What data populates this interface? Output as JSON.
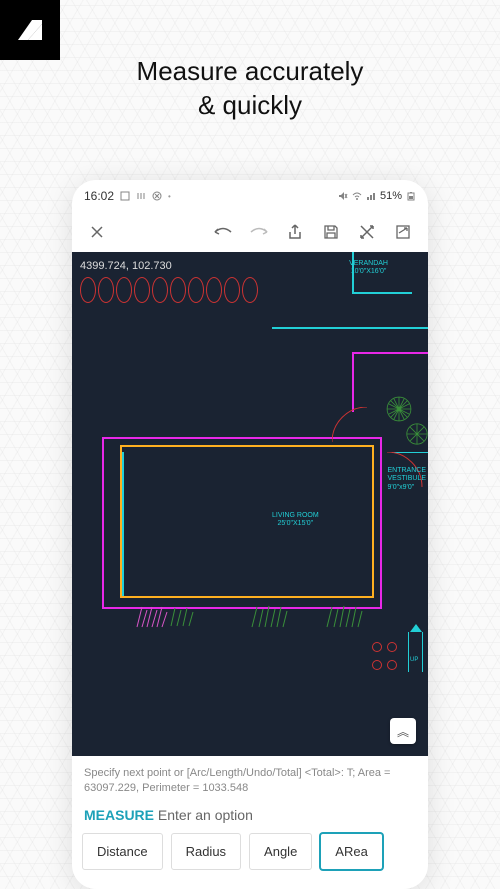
{
  "title_line1": "Measure accurately",
  "title_line2": "& quickly",
  "statusbar": {
    "time": "16:02",
    "battery": "51%"
  },
  "canvas": {
    "coords": "4399.724, 102.730",
    "verandah_label": "VERANDAH",
    "verandah_dim": "10'0\"X16'0\"",
    "living_label": "LIVING ROOM",
    "living_dim": "25'0\"X15'0\"",
    "entrance_label": "ENTRANCE",
    "entrance_label2": "VESTIBULE",
    "entrance_dim": "9'0\"x9'0\"",
    "fab_glyph": "︽",
    "up_label": "UP"
  },
  "cmdline": "Specify next point or [Arc/Length/Undo/Total] <Total>: T; Area = 63097.229, Perimeter = 1033.548",
  "prompt": {
    "command": "MEASURE",
    "text": "Enter an option"
  },
  "options": [
    {
      "label": "Distance"
    },
    {
      "label": "Radius"
    },
    {
      "label": "Angle"
    },
    {
      "label": "ARea"
    }
  ]
}
